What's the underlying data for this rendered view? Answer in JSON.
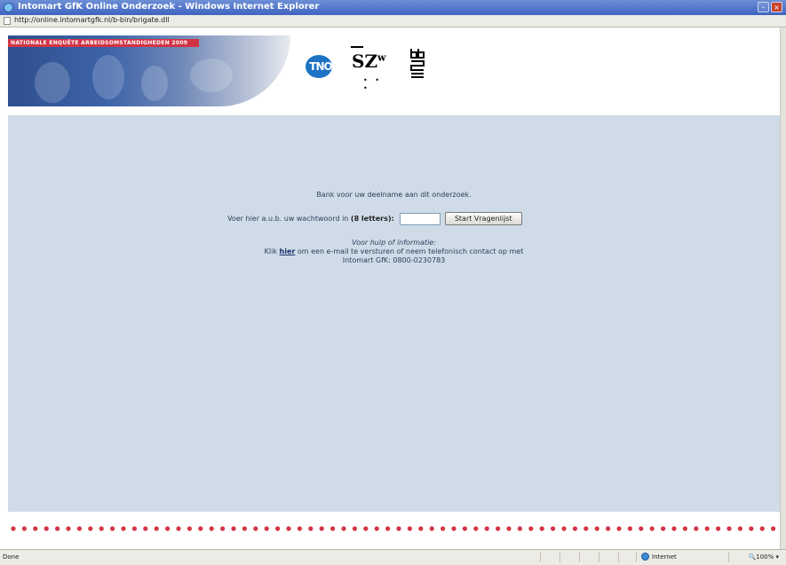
{
  "window": {
    "title": "Intomart GfK Online Onderzoek - Windows Internet Explorer",
    "minimize": "–",
    "close": "×"
  },
  "address": {
    "url": "http://online.intomartgfk.nl/b-bin/brigate.dll"
  },
  "banner": {
    "tagline": "NATIONALE ENQUÊTE ARBEIDSOMSTANDIGHEDEN 2009",
    "logo_tno": "TNO",
    "logo_szw": "SZ",
    "logo_szw_sup": "w"
  },
  "content": {
    "thanks": "Bank voor uw deelname aan dit onderzoek.",
    "password_prompt": "Voer hier a.u.b. uw wachtwoord in ",
    "password_hint": "(8 letters):",
    "start_button": "Start Vragenlijst",
    "help_heading": "Voor hulp of informatie:",
    "help_prefix": "Klik ",
    "help_link": "hier",
    "help_suffix": " om een e-mail te versturen of neem telefonisch contact op met",
    "contact": "Intomart GfK: 0800-0230783"
  },
  "statusbar": {
    "status": "Done",
    "zone": "Internet",
    "zoom": "100%"
  },
  "colors": {
    "band": "#cfdce8",
    "accent_red": "#d23445",
    "logo_blue": "#1d73c4"
  }
}
